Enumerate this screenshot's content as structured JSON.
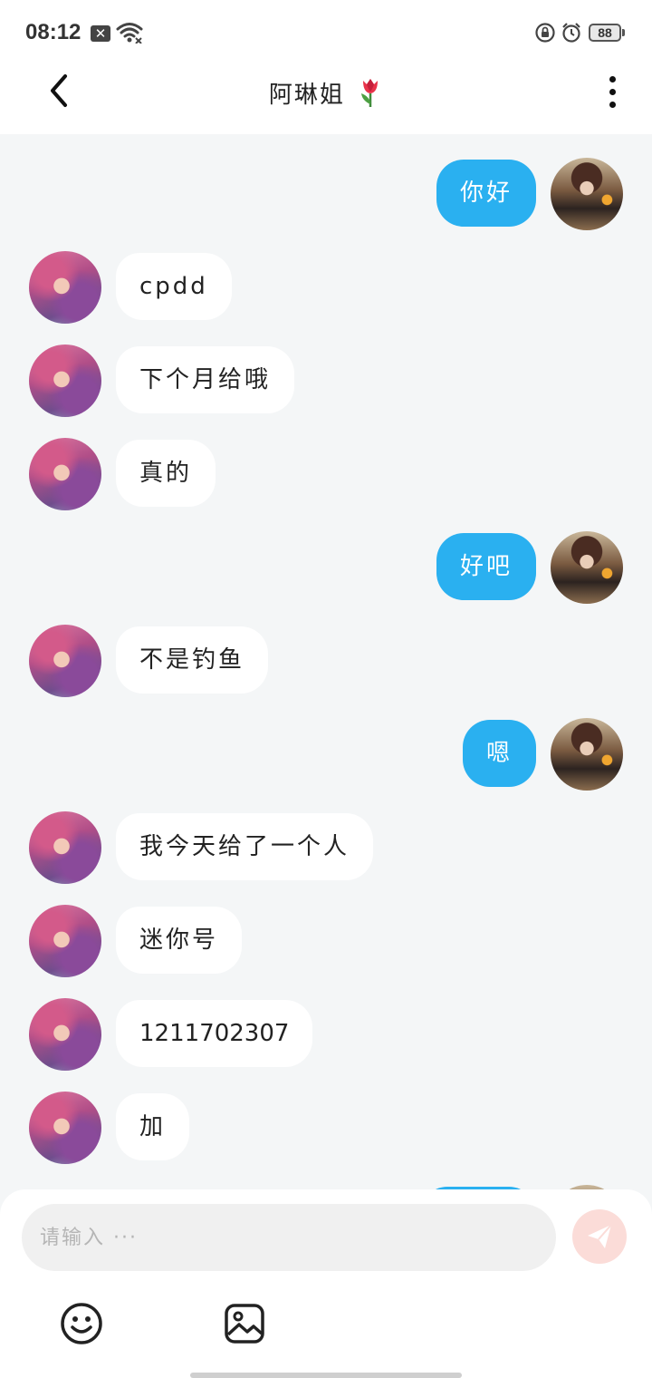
{
  "status_bar": {
    "time": "08:12",
    "sim_mark": "✕",
    "battery": "88",
    "icons": [
      "close-box-icon",
      "wifi-icon",
      "rotation-lock-icon",
      "alarm-icon",
      "battery-icon"
    ]
  },
  "header": {
    "title": "阿琳姐",
    "title_emoji": "tulip-icon",
    "back_icon": "chevron-left-icon",
    "more_icon": "more-vertical-icon"
  },
  "messages": [
    {
      "side": "right",
      "text": "你好"
    },
    {
      "side": "left",
      "text": "cpdd"
    },
    {
      "side": "left",
      "text": "下个月给哦"
    },
    {
      "side": "left",
      "text": "真的"
    },
    {
      "side": "right",
      "text": "好吧"
    },
    {
      "side": "left",
      "text": "不是钓鱼"
    },
    {
      "side": "right",
      "text": "嗯"
    },
    {
      "side": "left",
      "text": "我今天给了一个人"
    },
    {
      "side": "left",
      "text": "迷你号"
    },
    {
      "side": "left",
      "text": "1211702307"
    },
    {
      "side": "left",
      "text": "加"
    },
    {
      "side": "right",
      "text": ""
    }
  ],
  "composer": {
    "placeholder": "请输入 ···",
    "value": "",
    "send_icon": "send-icon",
    "tools": [
      "emoji-icon",
      "image-icon"
    ]
  },
  "colors": {
    "accent": "#2ab0f0",
    "background": "#f4f6f7",
    "send_button": "#fbdcd8"
  }
}
